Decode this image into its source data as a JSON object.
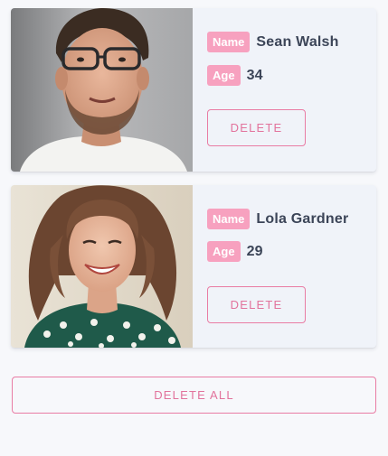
{
  "profiles": [
    {
      "name_tag": "Name",
      "name": "Sean Walsh",
      "age_tag": "Age",
      "age": "34",
      "delete_label": "DELETE"
    },
    {
      "name_tag": "Name",
      "name": "Lola Gardner",
      "age_tag": "Age",
      "age": "29",
      "delete_label": "DELETE"
    }
  ],
  "actions": {
    "delete_all_label": "DELETE ALL"
  },
  "colors": {
    "accent": "#e97ca4",
    "tag_bg": "#f7a1bf",
    "card_bg": "#f0f3f9",
    "page_bg": "#f7f8fb",
    "text": "#3c4558"
  }
}
